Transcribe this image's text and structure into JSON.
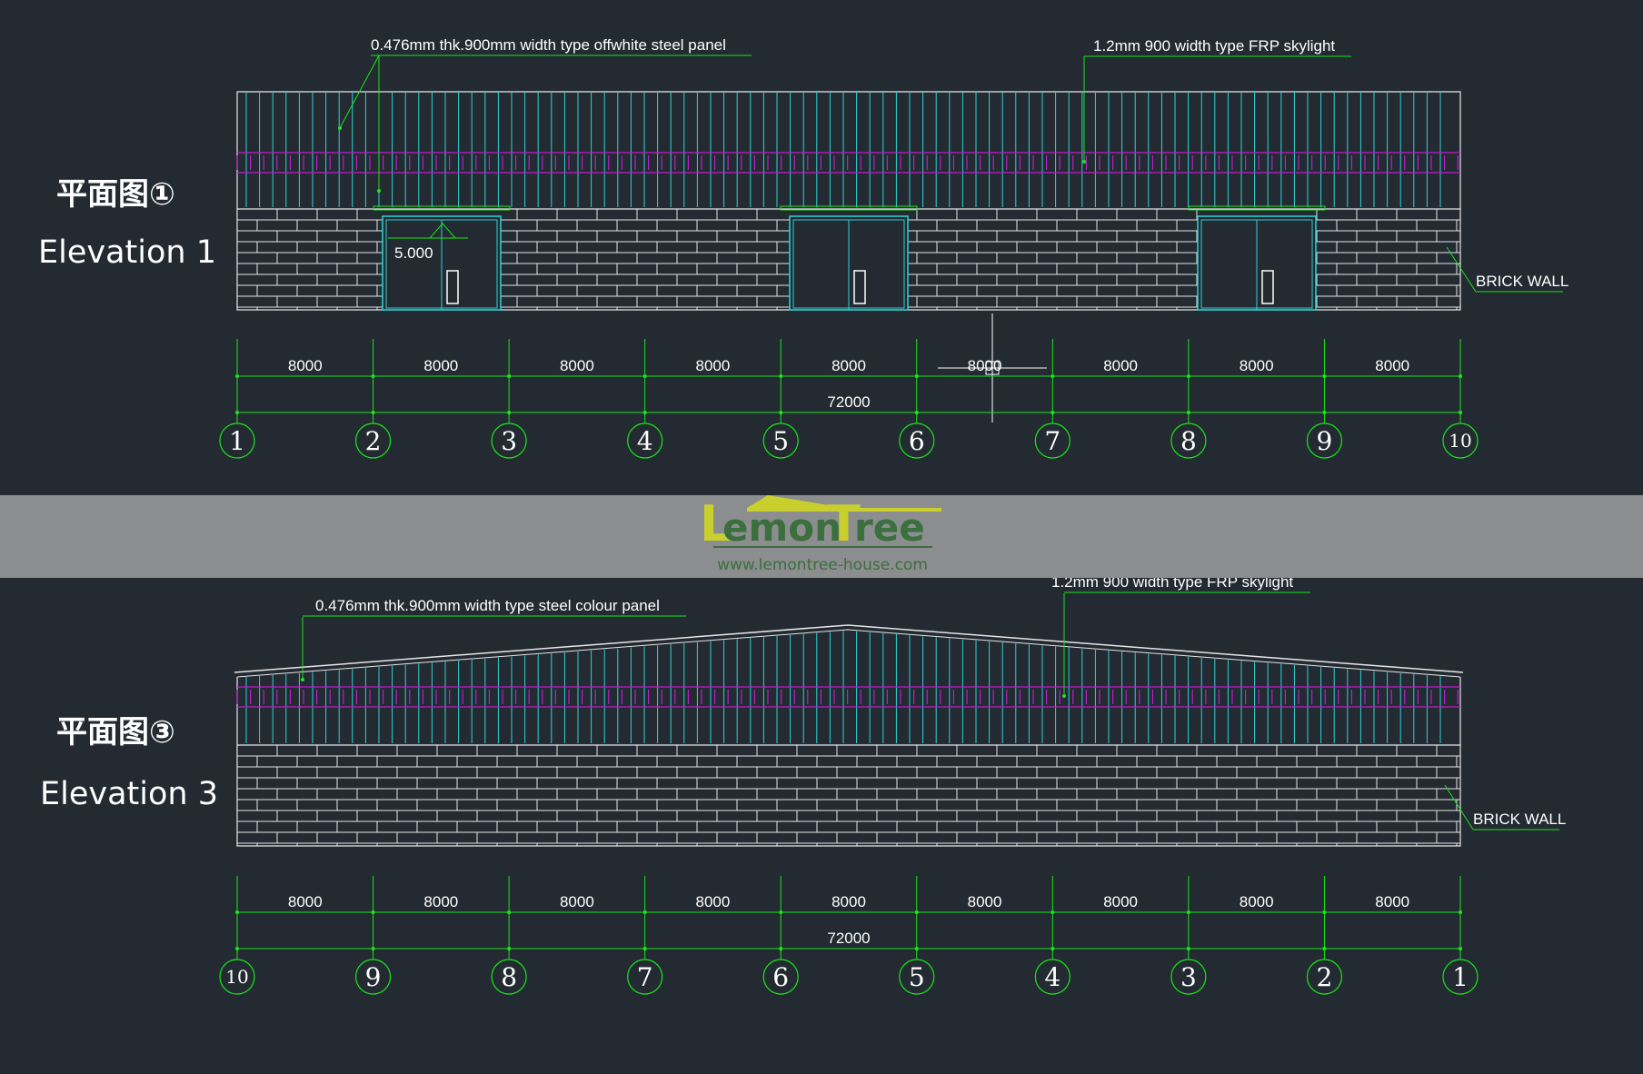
{
  "brand": {
    "name_part1": "L",
    "name_part2": "emon",
    "name_part3": "T",
    "name_part4": "ree",
    "website": "www.lemontree-house.com",
    "color_primary": "#c9cf2c",
    "color_secondary": "#3b6f3e"
  },
  "colors": {
    "background": "#232a32",
    "dimension_lines": "#19e619",
    "panel_lines": "#2ed3d3",
    "skylight": "#c21bcc",
    "brick": "#e6e6e6",
    "text": "#ffffff"
  },
  "elevation1": {
    "title_cn": "平面图①",
    "title_en": "Elevation 1",
    "panel_label": "0.476mm thk.900mm width type offwhite steel panel",
    "skylight_label": "1.2mm 900 width type FRP skylight",
    "wall_label": "BRICK WALL",
    "door_height_label": "5.000",
    "bays": [
      "8000",
      "8000",
      "8000",
      "8000",
      "8000",
      "8000",
      "8000",
      "8000",
      "8000"
    ],
    "total": "72000",
    "axes": [
      "1",
      "2",
      "3",
      "4",
      "5",
      "6",
      "7",
      "8",
      "9",
      "10"
    ]
  },
  "elevation3": {
    "title_cn": "平面图③",
    "title_en": "Elevation 3",
    "panel_label": "0.476mm thk.900mm width type steel colour panel",
    "skylight_label": "1.2mm 900 width type FRP skylight",
    "wall_label": "BRICK WALL",
    "bays": [
      "8000",
      "8000",
      "8000",
      "8000",
      "8000",
      "8000",
      "8000",
      "8000",
      "8000"
    ],
    "total": "72000",
    "axes": [
      "10",
      "9",
      "8",
      "7",
      "6",
      "5",
      "4",
      "3",
      "2",
      "1"
    ]
  }
}
